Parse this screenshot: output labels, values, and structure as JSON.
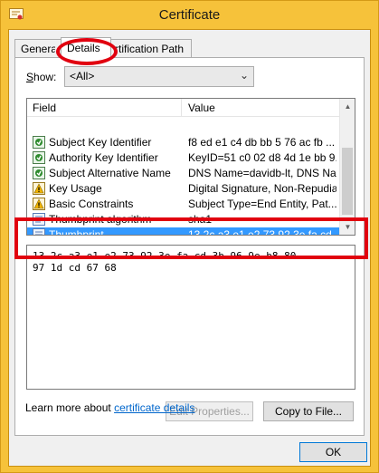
{
  "window": {
    "title": "Certificate"
  },
  "tabs": [
    {
      "label": "General",
      "visible_label": "Genera"
    },
    {
      "label": "Details"
    },
    {
      "label": "Certification Path",
      "visible_label": "rtification Path"
    }
  ],
  "show": {
    "label": "Show:",
    "label_accel": "S",
    "label_rest": "how:",
    "selected": "<All>"
  },
  "list": {
    "columns": [
      "Field",
      "Value"
    ],
    "rows": [
      {
        "icon": "cert-extension-icon",
        "field": "Subject Key Identifier",
        "value": "f8 ed e1 c4 db bb 5 76 ac fb ..."
      },
      {
        "icon": "cert-extension-icon",
        "field": "Authority Key Identifier",
        "value": "KeyID=51 c0 02 d8 4d 1e bb 9..."
      },
      {
        "icon": "cert-extension-icon",
        "field": "Subject Alternative Name",
        "value": "DNS Name=davidb-lt, DNS Na..."
      },
      {
        "icon": "critical-extension-icon",
        "field": "Key Usage",
        "value": "Digital Signature, Non-Repudia..."
      },
      {
        "icon": "critical-extension-icon",
        "field": "Basic Constraints",
        "value": "Subject Type=End Entity, Pat..."
      },
      {
        "icon": "property-icon",
        "field": "Thumbprint algorithm",
        "value": "sha1"
      },
      {
        "icon": "property-icon",
        "field": "Thumbprint",
        "value": "13 2c a3 e1 e2 73 92 3e fa cd ...",
        "selected": true
      }
    ]
  },
  "value_box": {
    "text": "13 2c a3 e1 e2 73 92 3e fa cd 3b 96 9e b8 80\n97 1d cd 67 68"
  },
  "buttons": {
    "edit_properties": "Edit Properties...",
    "copy_to_file": "Copy to File...",
    "ok": "OK"
  },
  "learn_more": {
    "prefix": "Learn more about ",
    "link": "certificate details"
  },
  "colors": {
    "title_bar": "#f6c23a",
    "highlight": "#e1000f",
    "selection": "#3399ff",
    "link": "#0066cc"
  }
}
